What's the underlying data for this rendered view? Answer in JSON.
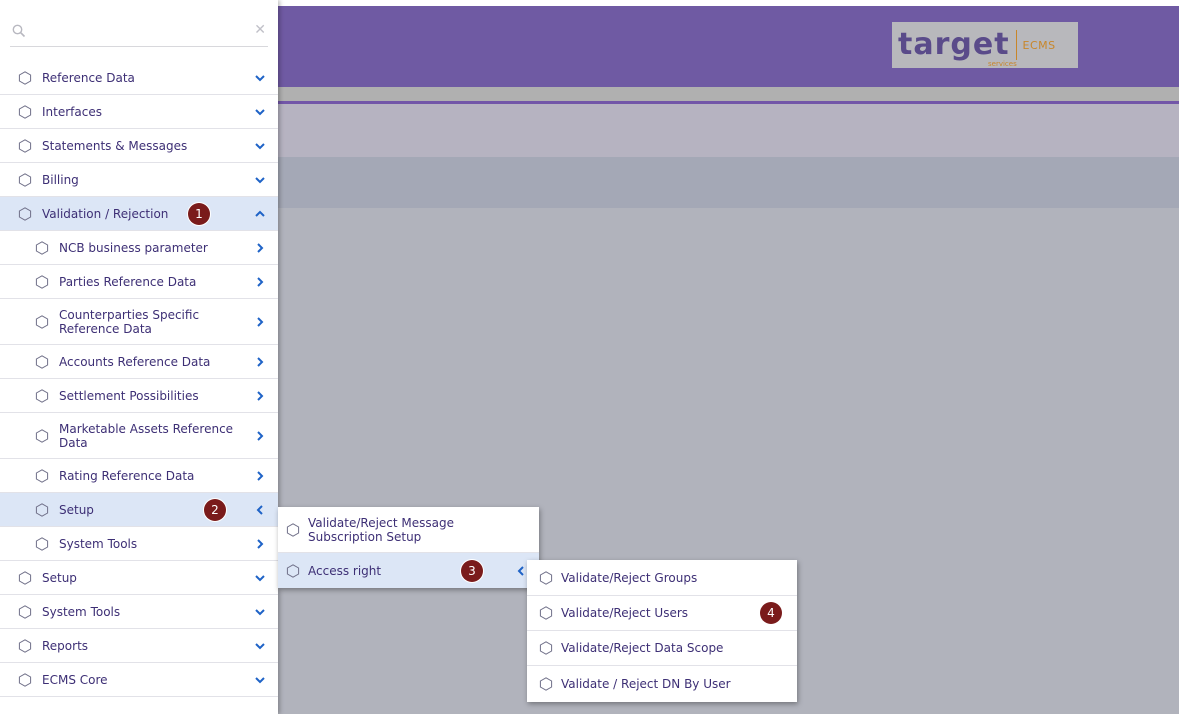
{
  "header": {
    "logo": {
      "word": "target",
      "sub": "services",
      "tag": "ECMS"
    }
  },
  "search": {
    "placeholder": "",
    "value": ""
  },
  "menu": {
    "items": [
      {
        "label": "Reference Data"
      },
      {
        "label": "Interfaces"
      },
      {
        "label": "Statements & Messages"
      },
      {
        "label": "Billing"
      },
      {
        "label": "Validation / Rejection",
        "expanded": true,
        "badge": "1",
        "children": [
          {
            "label": "NCB business parameter"
          },
          {
            "label": "Parties Reference Data"
          },
          {
            "label": "Counterparties Specific Reference Data"
          },
          {
            "label": "Accounts Reference Data"
          },
          {
            "label": "Settlement Possibilities"
          },
          {
            "label": "Marketable Assets Reference Data"
          },
          {
            "label": "Rating Reference Data"
          },
          {
            "label": "Setup",
            "active": true,
            "badge": "2"
          },
          {
            "label": "System Tools"
          }
        ]
      },
      {
        "label": "Setup"
      },
      {
        "label": "System Tools"
      },
      {
        "label": "Reports"
      },
      {
        "label": "ECMS Core"
      }
    ]
  },
  "flyout_setup": {
    "items": [
      {
        "label": "Validate/Reject Message Subscription Setup"
      },
      {
        "label": "Access right",
        "active": true,
        "badge": "3"
      }
    ]
  },
  "flyout_access_right": {
    "items": [
      {
        "label": "Validate/Reject Groups"
      },
      {
        "label": "Validate/Reject Users",
        "badge": "4"
      },
      {
        "label": "Validate/Reject Data Scope"
      },
      {
        "label": "Validate / Reject DN By User"
      }
    ]
  },
  "colors": {
    "header": "#6f5aa3",
    "menu_text": "#3d2f75",
    "active_bg": "#dce6f6",
    "chevron": "#1f63c7",
    "badge": "#7a1b1b",
    "logo_accent": "#c8862a"
  }
}
